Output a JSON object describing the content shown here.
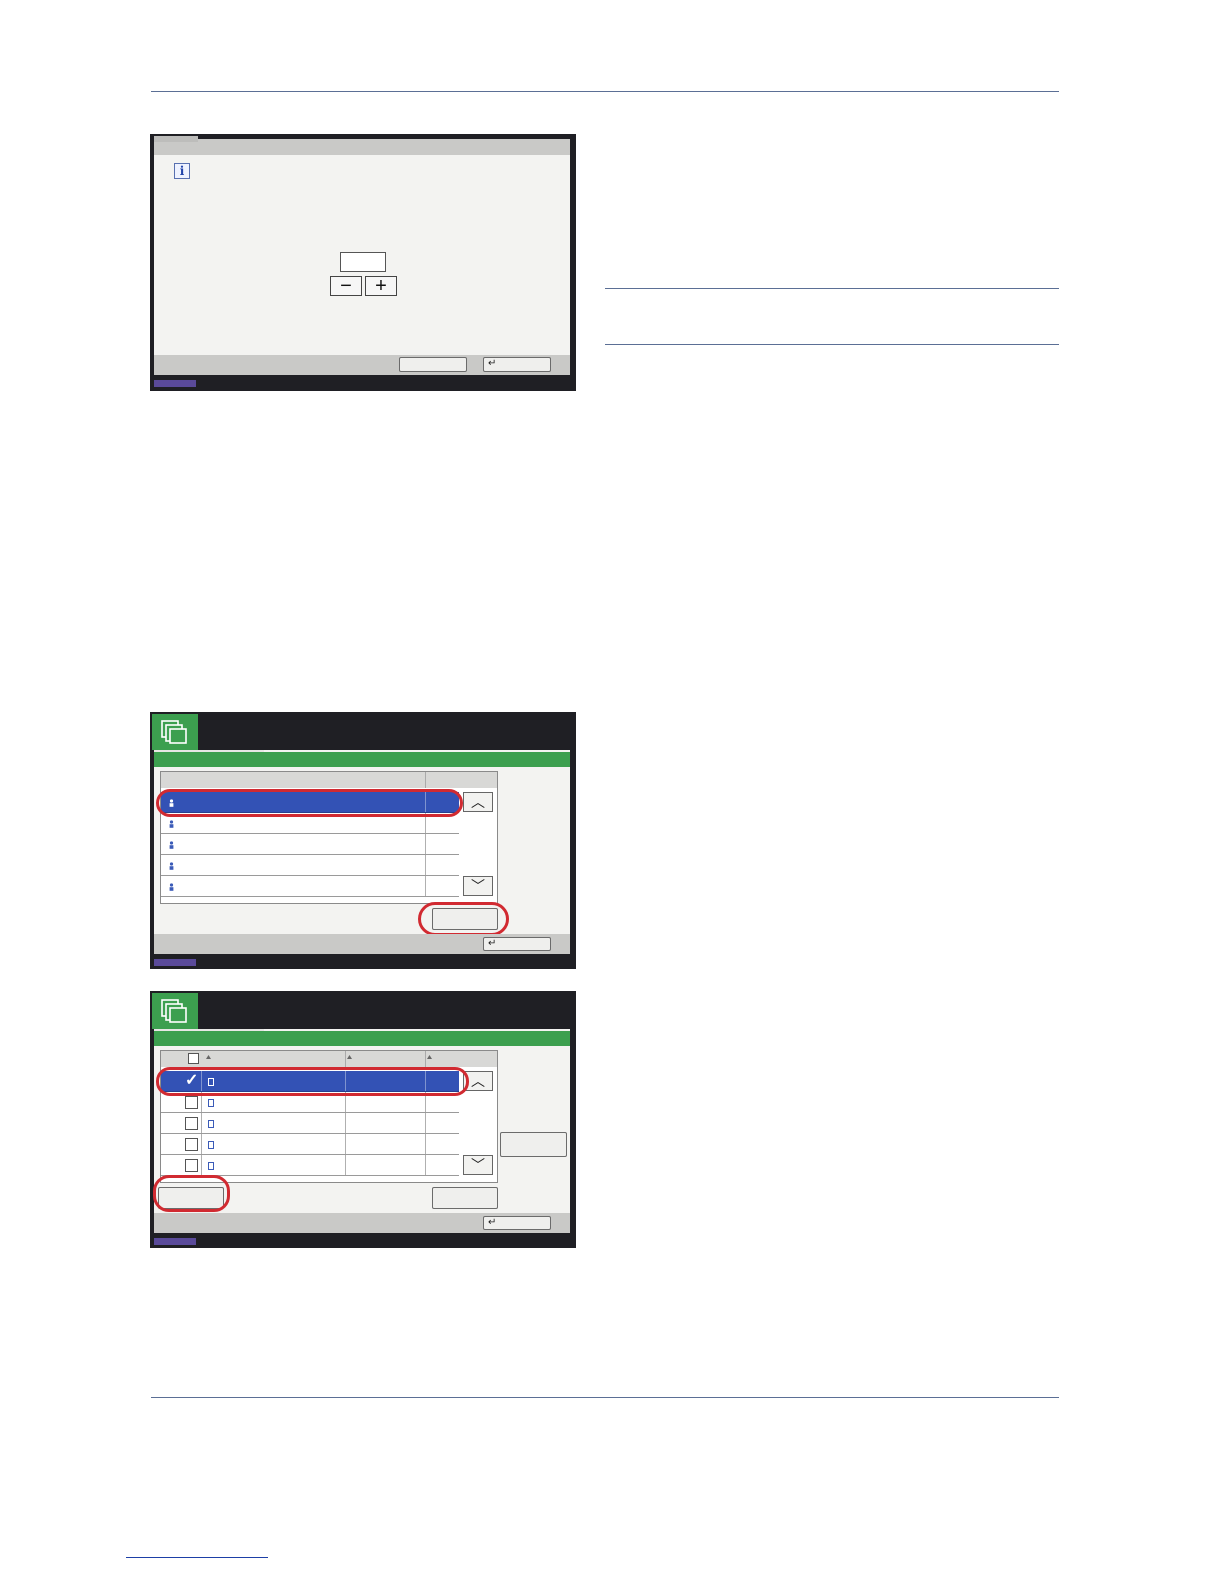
{
  "page": {
    "background": "#ffffff",
    "rule_color": "#5b6f95"
  },
  "figure1": {
    "info_icon": "info-icon",
    "stepper_value": "",
    "minus_symbol": "−",
    "plus_symbol": "+",
    "cancel_label": "",
    "enter_label": "↵"
  },
  "figure2": {
    "app_icon": "document-box-icon",
    "rows": [
      {
        "selected": true
      },
      {
        "selected": false
      },
      {
        "selected": false
      },
      {
        "selected": false
      },
      {
        "selected": false
      }
    ],
    "scroll_up": "︿",
    "scroll_down": "﹀",
    "open_label": "",
    "enter_label": "↵"
  },
  "figure3": {
    "app_icon": "document-box-icon",
    "rows": [
      {
        "selected": true,
        "checked": true
      },
      {
        "selected": false,
        "checked": false
      },
      {
        "selected": false,
        "checked": false
      },
      {
        "selected": false,
        "checked": false
      },
      {
        "selected": false,
        "checked": false
      }
    ],
    "check_mark": "✓",
    "scroll_up": "︿",
    "scroll_down": "﹀",
    "side_button_label": "",
    "left_button_label": "",
    "middle_button_label": "",
    "enter_label": "↵"
  },
  "colors": {
    "highlight": "#d12a31",
    "selection": "#3352b5",
    "status_tab": "#5a4a9a",
    "brand_green": "#3c9f4f"
  }
}
